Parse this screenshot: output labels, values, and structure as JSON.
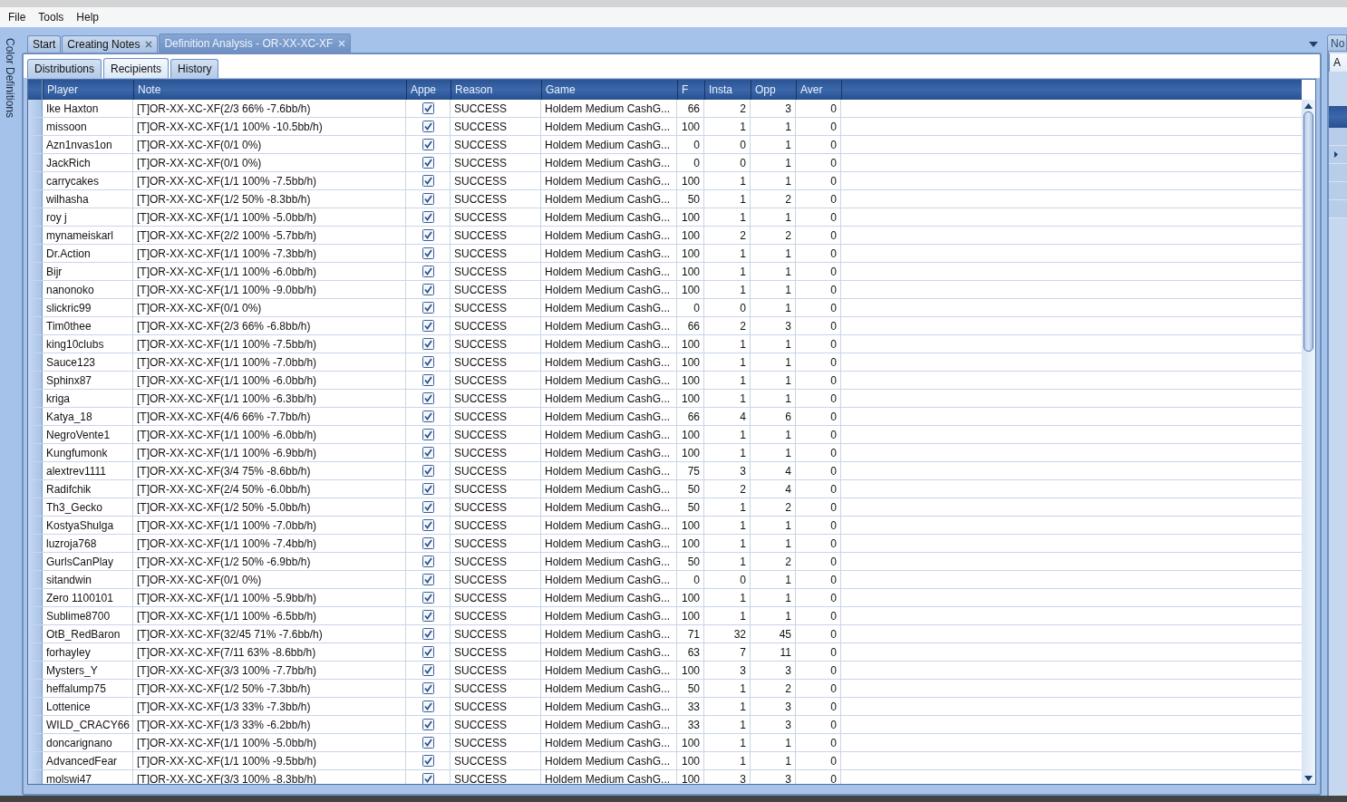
{
  "menu": [
    "File",
    "Tools",
    "Help"
  ],
  "side_panel": {
    "title": "Color Definitions"
  },
  "document_tabs": [
    {
      "label": "Start",
      "selected": false,
      "closable": false
    },
    {
      "label": "Creating Notes",
      "selected": false,
      "closable": true
    },
    {
      "label": "Definition Analysis - OR-XX-XC-XF",
      "selected": true,
      "closable": true
    }
  ],
  "sub_tabs": [
    {
      "label": "Distributions",
      "selected": false
    },
    {
      "label": "Recipients",
      "selected": true
    },
    {
      "label": "History",
      "selected": false
    }
  ],
  "table": {
    "columns": [
      {
        "label": "Player",
        "kind": "text"
      },
      {
        "label": "Note",
        "kind": "text"
      },
      {
        "label": "Appe",
        "kind": "check"
      },
      {
        "label": "Reason",
        "kind": "text"
      },
      {
        "label": "Game",
        "kind": "text"
      },
      {
        "label": "F",
        "kind": "number"
      },
      {
        "label": "Insta",
        "kind": "number"
      },
      {
        "label": "Opp",
        "kind": "number"
      },
      {
        "label": "Aver",
        "kind": "number"
      }
    ],
    "rows": [
      {
        "cells": [
          "Ike Haxton",
          "[T]OR-XX-XC-XF(2/3 66% -7.6bb/h)",
          {
            "checked": true
          },
          "SUCCESS",
          "Holdem Medium CashG...",
          "66",
          "2",
          "3",
          "0"
        ]
      },
      {
        "cells": [
          "missoon",
          "[T]OR-XX-XC-XF(1/1 100% -10.5bb/h)",
          {
            "checked": true
          },
          "SUCCESS",
          "Holdem Medium CashG...",
          "100",
          "1",
          "1",
          "0"
        ]
      },
      {
        "cells": [
          "Azn1nvas1on",
          "[T]OR-XX-XC-XF(0/1 0%)",
          {
            "checked": true
          },
          "SUCCESS",
          "Holdem Medium CashG...",
          "0",
          "0",
          "1",
          "0"
        ]
      },
      {
        "cells": [
          "JackRich",
          "[T]OR-XX-XC-XF(0/1 0%)",
          {
            "checked": true
          },
          "SUCCESS",
          "Holdem Medium CashG...",
          "0",
          "0",
          "1",
          "0"
        ]
      },
      {
        "cells": [
          "carrycakes",
          "[T]OR-XX-XC-XF(1/1 100% -7.5bb/h)",
          {
            "checked": true
          },
          "SUCCESS",
          "Holdem Medium CashG...",
          "100",
          "1",
          "1",
          "0"
        ]
      },
      {
        "cells": [
          "wilhasha",
          "[T]OR-XX-XC-XF(1/2 50% -8.3bb/h)",
          {
            "checked": true
          },
          "SUCCESS",
          "Holdem Medium CashG...",
          "50",
          "1",
          "2",
          "0"
        ]
      },
      {
        "cells": [
          "roy j",
          "[T]OR-XX-XC-XF(1/1 100% -5.0bb/h)",
          {
            "checked": true
          },
          "SUCCESS",
          "Holdem Medium CashG...",
          "100",
          "1",
          "1",
          "0"
        ]
      },
      {
        "cells": [
          "mynameiskarl",
          "[T]OR-XX-XC-XF(2/2 100% -5.7bb/h)",
          {
            "checked": true
          },
          "SUCCESS",
          "Holdem Medium CashG...",
          "100",
          "2",
          "2",
          "0"
        ]
      },
      {
        "cells": [
          "Dr.Action",
          "[T]OR-XX-XC-XF(1/1 100% -7.3bb/h)",
          {
            "checked": true
          },
          "SUCCESS",
          "Holdem Medium CashG...",
          "100",
          "1",
          "1",
          "0"
        ]
      },
      {
        "cells": [
          "Bijr",
          "[T]OR-XX-XC-XF(1/1 100% -6.0bb/h)",
          {
            "checked": true
          },
          "SUCCESS",
          "Holdem Medium CashG...",
          "100",
          "1",
          "1",
          "0"
        ]
      },
      {
        "cells": [
          "nanonoko",
          "[T]OR-XX-XC-XF(1/1 100% -9.0bb/h)",
          {
            "checked": true
          },
          "SUCCESS",
          "Holdem Medium CashG...",
          "100",
          "1",
          "1",
          "0"
        ]
      },
      {
        "cells": [
          "slickric99",
          "[T]OR-XX-XC-XF(0/1 0%)",
          {
            "checked": true
          },
          "SUCCESS",
          "Holdem Medium CashG...",
          "0",
          "0",
          "1",
          "0"
        ]
      },
      {
        "cells": [
          "Tim0thee",
          "[T]OR-XX-XC-XF(2/3 66% -6.8bb/h)",
          {
            "checked": true
          },
          "SUCCESS",
          "Holdem Medium CashG...",
          "66",
          "2",
          "3",
          "0"
        ]
      },
      {
        "cells": [
          "king10clubs",
          "[T]OR-XX-XC-XF(1/1 100% -7.5bb/h)",
          {
            "checked": true
          },
          "SUCCESS",
          "Holdem Medium CashG...",
          "100",
          "1",
          "1",
          "0"
        ]
      },
      {
        "cells": [
          "Sauce123",
          "[T]OR-XX-XC-XF(1/1 100% -7.0bb/h)",
          {
            "checked": true
          },
          "SUCCESS",
          "Holdem Medium CashG...",
          "100",
          "1",
          "1",
          "0"
        ]
      },
      {
        "cells": [
          "Sphinx87",
          "[T]OR-XX-XC-XF(1/1 100% -6.0bb/h)",
          {
            "checked": true
          },
          "SUCCESS",
          "Holdem Medium CashG...",
          "100",
          "1",
          "1",
          "0"
        ]
      },
      {
        "cells": [
          "kriga",
          "[T]OR-XX-XC-XF(1/1 100% -6.3bb/h)",
          {
            "checked": true
          },
          "SUCCESS",
          "Holdem Medium CashG...",
          "100",
          "1",
          "1",
          "0"
        ]
      },
      {
        "cells": [
          "Katya_18",
          "[T]OR-XX-XC-XF(4/6 66% -7.7bb/h)",
          {
            "checked": true
          },
          "SUCCESS",
          "Holdem Medium CashG...",
          "66",
          "4",
          "6",
          "0"
        ]
      },
      {
        "cells": [
          "NegroVente1",
          "[T]OR-XX-XC-XF(1/1 100% -6.0bb/h)",
          {
            "checked": true
          },
          "SUCCESS",
          "Holdem Medium CashG...",
          "100",
          "1",
          "1",
          "0"
        ]
      },
      {
        "cells": [
          "Kungfumonk",
          "[T]OR-XX-XC-XF(1/1 100% -6.9bb/h)",
          {
            "checked": true
          },
          "SUCCESS",
          "Holdem Medium CashG...",
          "100",
          "1",
          "1",
          "0"
        ]
      },
      {
        "cells": [
          "alextrev1111",
          "[T]OR-XX-XC-XF(3/4 75% -8.6bb/h)",
          {
            "checked": true
          },
          "SUCCESS",
          "Holdem Medium CashG...",
          "75",
          "3",
          "4",
          "0"
        ]
      },
      {
        "cells": [
          "Radifchik",
          "[T]OR-XX-XC-XF(2/4 50% -6.0bb/h)",
          {
            "checked": true
          },
          "SUCCESS",
          "Holdem Medium CashG...",
          "50",
          "2",
          "4",
          "0"
        ]
      },
      {
        "cells": [
          "Th3_Gecko",
          "[T]OR-XX-XC-XF(1/2 50% -5.0bb/h)",
          {
            "checked": true
          },
          "SUCCESS",
          "Holdem Medium CashG...",
          "50",
          "1",
          "2",
          "0"
        ]
      },
      {
        "cells": [
          "KostyaShulga",
          "[T]OR-XX-XC-XF(1/1 100% -7.0bb/h)",
          {
            "checked": true
          },
          "SUCCESS",
          "Holdem Medium CashG...",
          "100",
          "1",
          "1",
          "0"
        ]
      },
      {
        "cells": [
          "luzroja768",
          "[T]OR-XX-XC-XF(1/1 100% -7.4bb/h)",
          {
            "checked": true
          },
          "SUCCESS",
          "Holdem Medium CashG...",
          "100",
          "1",
          "1",
          "0"
        ]
      },
      {
        "cells": [
          "GurlsCanPlay",
          "[T]OR-XX-XC-XF(1/2 50% -6.9bb/h)",
          {
            "checked": true
          },
          "SUCCESS",
          "Holdem Medium CashG...",
          "50",
          "1",
          "2",
          "0"
        ]
      },
      {
        "cells": [
          "sitandwin",
          "[T]OR-XX-XC-XF(0/1 0%)",
          {
            "checked": true
          },
          "SUCCESS",
          "Holdem Medium CashG...",
          "0",
          "0",
          "1",
          "0"
        ]
      },
      {
        "cells": [
          "Zero 1100101",
          "[T]OR-XX-XC-XF(1/1 100% -5.9bb/h)",
          {
            "checked": true
          },
          "SUCCESS",
          "Holdem Medium CashG...",
          "100",
          "1",
          "1",
          "0"
        ]
      },
      {
        "cells": [
          "Sublime8700",
          "[T]OR-XX-XC-XF(1/1 100% -6.5bb/h)",
          {
            "checked": true
          },
          "SUCCESS",
          "Holdem Medium CashG...",
          "100",
          "1",
          "1",
          "0"
        ]
      },
      {
        "cells": [
          "OtB_RedBaron",
          "[T]OR-XX-XC-XF(32/45 71% -7.6bb/h)",
          {
            "checked": true
          },
          "SUCCESS",
          "Holdem Medium CashG...",
          "71",
          "32",
          "45",
          "0"
        ]
      },
      {
        "cells": [
          "forhayley",
          "[T]OR-XX-XC-XF(7/11 63% -8.6bb/h)",
          {
            "checked": true
          },
          "SUCCESS",
          "Holdem Medium CashG...",
          "63",
          "7",
          "11",
          "0"
        ]
      },
      {
        "cells": [
          "Mysters_Y",
          "[T]OR-XX-XC-XF(3/3 100% -7.7bb/h)",
          {
            "checked": true
          },
          "SUCCESS",
          "Holdem Medium CashG...",
          "100",
          "3",
          "3",
          "0"
        ]
      },
      {
        "cells": [
          "heffalump75",
          "[T]OR-XX-XC-XF(1/2 50% -7.3bb/h)",
          {
            "checked": true
          },
          "SUCCESS",
          "Holdem Medium CashG...",
          "50",
          "1",
          "2",
          "0"
        ]
      },
      {
        "cells": [
          "Lottenice",
          "[T]OR-XX-XC-XF(1/3 33% -7.3bb/h)",
          {
            "checked": true
          },
          "SUCCESS",
          "Holdem Medium CashG...",
          "33",
          "1",
          "3",
          "0"
        ]
      },
      {
        "cells": [
          "WILD_CRACY66",
          "[T]OR-XX-XC-XF(1/3 33% -6.2bb/h)",
          {
            "checked": true
          },
          "SUCCESS",
          "Holdem Medium CashG...",
          "33",
          "1",
          "3",
          "0"
        ]
      },
      {
        "cells": [
          "doncarignano",
          "[T]OR-XX-XC-XF(1/1 100% -5.0bb/h)",
          {
            "checked": true
          },
          "SUCCESS",
          "Holdem Medium CashG...",
          "100",
          "1",
          "1",
          "0"
        ]
      },
      {
        "cells": [
          "AdvancedFear",
          "[T]OR-XX-XC-XF(1/1 100% -9.5bb/h)",
          {
            "checked": true
          },
          "SUCCESS",
          "Holdem Medium CashG...",
          "100",
          "1",
          "1",
          "0"
        ]
      },
      {
        "cells": [
          "molswi47",
          "[T]OR-XX-XC-XF(3/3 100% -8.3bb/h)",
          {
            "checked": true
          },
          "SUCCESS",
          "Holdem Medium CashG...",
          "100",
          "3",
          "3",
          "0"
        ]
      }
    ]
  },
  "right_panel": {
    "tab": "No",
    "sub_tab": "A"
  }
}
